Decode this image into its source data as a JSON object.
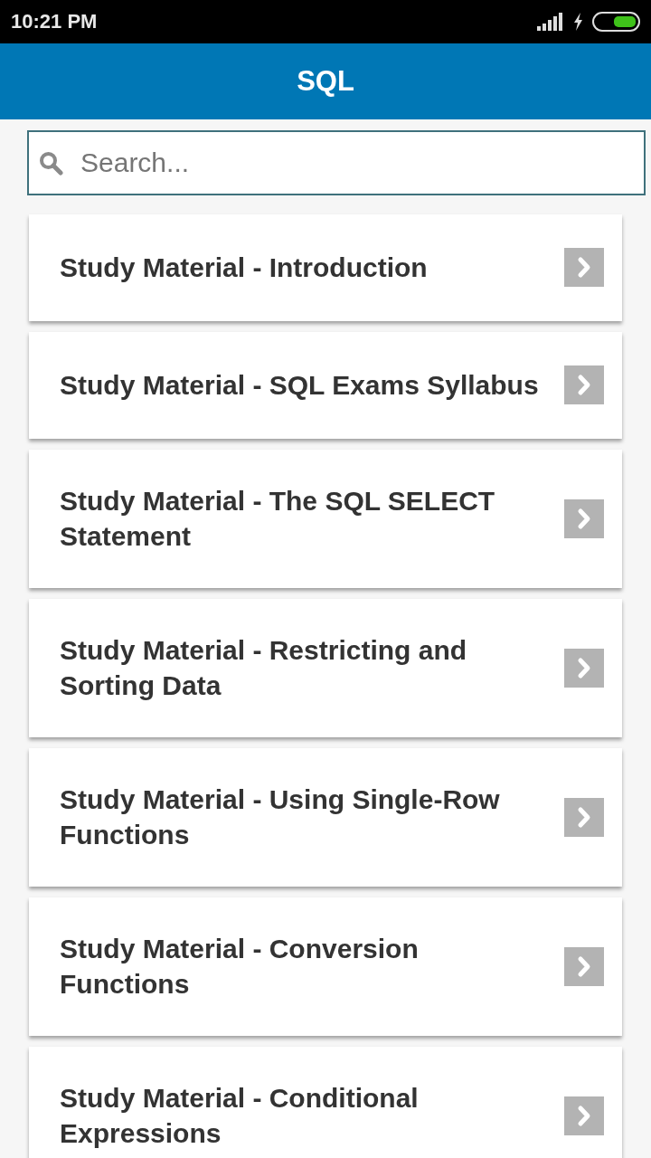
{
  "status_bar": {
    "time": "10:21 PM"
  },
  "app_bar": {
    "title": "SQL"
  },
  "search": {
    "placeholder": "Search..."
  },
  "items": [
    {
      "title": "Study Material - Introduction"
    },
    {
      "title": "Study Material - SQL Exams Syllabus"
    },
    {
      "title": "Study Material - The SQL SELECT Statement"
    },
    {
      "title": "Study Material - Restricting and Sorting Data"
    },
    {
      "title": "Study Material - Using Single-Row Functions"
    },
    {
      "title": "Study Material - Conversion Functions"
    },
    {
      "title": "Study Material - Conditional Expressions"
    }
  ]
}
